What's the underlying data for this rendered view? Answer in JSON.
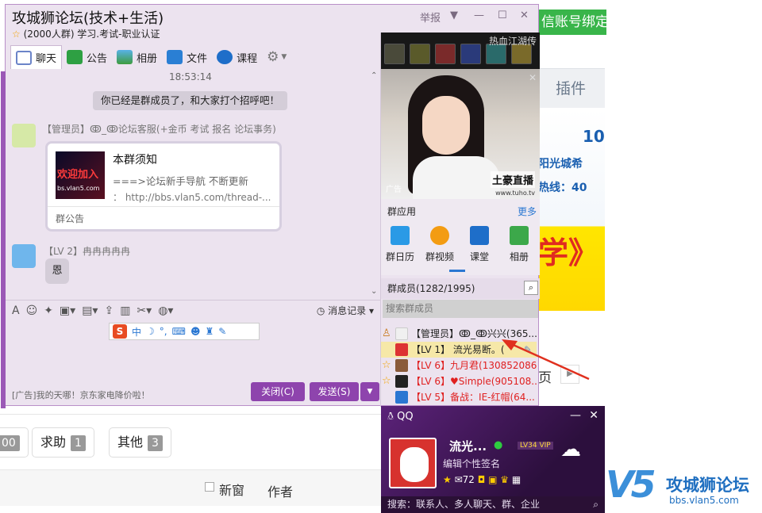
{
  "background": {
    "banner": "信账号绑定",
    "plugin_tab": "插件",
    "ad_lines": [
      "10",
      "阳光城希",
      "热线：40",
      "学》"
    ],
    "page_label": "页",
    "categories": [
      {
        "label": "",
        "count": "00"
      },
      {
        "label": "求助",
        "count": "1"
      },
      {
        "label": "其他",
        "count": "3"
      }
    ],
    "new_window": "新窗",
    "author": "作者",
    "logo_name": "攻城狮论坛",
    "logo_url": "bbs.vlan5.com"
  },
  "chat": {
    "title": "攻城狮论坛(技术+生活)",
    "subtitle": "(2000人群) 学习.考试-职业认证",
    "report": "举报",
    "toolbar": [
      {
        "label": "聊天",
        "icon": "chat-icon"
      },
      {
        "label": "公告",
        "icon": "announcement-icon"
      },
      {
        "label": "相册",
        "icon": "album-icon"
      },
      {
        "label": "文件",
        "icon": "file-icon"
      },
      {
        "label": "课程",
        "icon": "course-icon"
      }
    ],
    "time": "18:53:14",
    "system_msg": "你已经是群成员了，和大家打个招呼吧！",
    "admin_sender": "【管理员】ↂ_ↂ论坛客服(+金币 考试 报名 论坛事务)",
    "card": {
      "image_text": "欢迎加入",
      "image_url": "bs.vlan5.com",
      "title": "本群须知",
      "line1": "===>论坛新手导航 不断更新",
      "line2": "：  http://bbs.vlan5.com/thread-...",
      "footer": "群公告"
    },
    "user_sender": "【LV 2】冉冉冉冉冉",
    "user_msg": "恩",
    "history": "消息记录",
    "ad": "[广告]我的天哪！京东家电降价啦！",
    "close_btn": "关闭(C)",
    "send_btn": "发送(S)"
  },
  "right_panel": {
    "game_title": "热血江湖传",
    "ad_tag": "广告",
    "brand": "土豪直播",
    "brand_url": "www.tuho.tv",
    "apps_title": "群应用",
    "apps_more": "更多",
    "apps": [
      "群日历",
      "群视频",
      "课堂",
      "相册"
    ],
    "members_title": "群成员(1282/1995)",
    "search_placeholder": "搜索群成员",
    "members": [
      {
        "name": "【管理员】ↂ_ↂ兴兴(365...",
        "color": "#222222",
        "star": false
      },
      {
        "name": "【LV 1】  流光易断。(",
        "color": "#222222",
        "star": false
      },
      {
        "name": "【LV 6】九月君(130852086...",
        "color": "#e02020",
        "star": true
      },
      {
        "name": "【LV 6】♥Simple(905108...",
        "color": "#e02020",
        "star": true
      },
      {
        "name": "【LV 5】备战：IE-红帽(64...",
        "color": "#e02020",
        "star": false
      }
    ]
  },
  "qq": {
    "title": "QQ",
    "nickname": "流光...",
    "level": "LV34 VIP",
    "signature": "编辑个性签名",
    "mail_count": "72",
    "search": "搜索：联系人、多人聊天、群、企业"
  }
}
